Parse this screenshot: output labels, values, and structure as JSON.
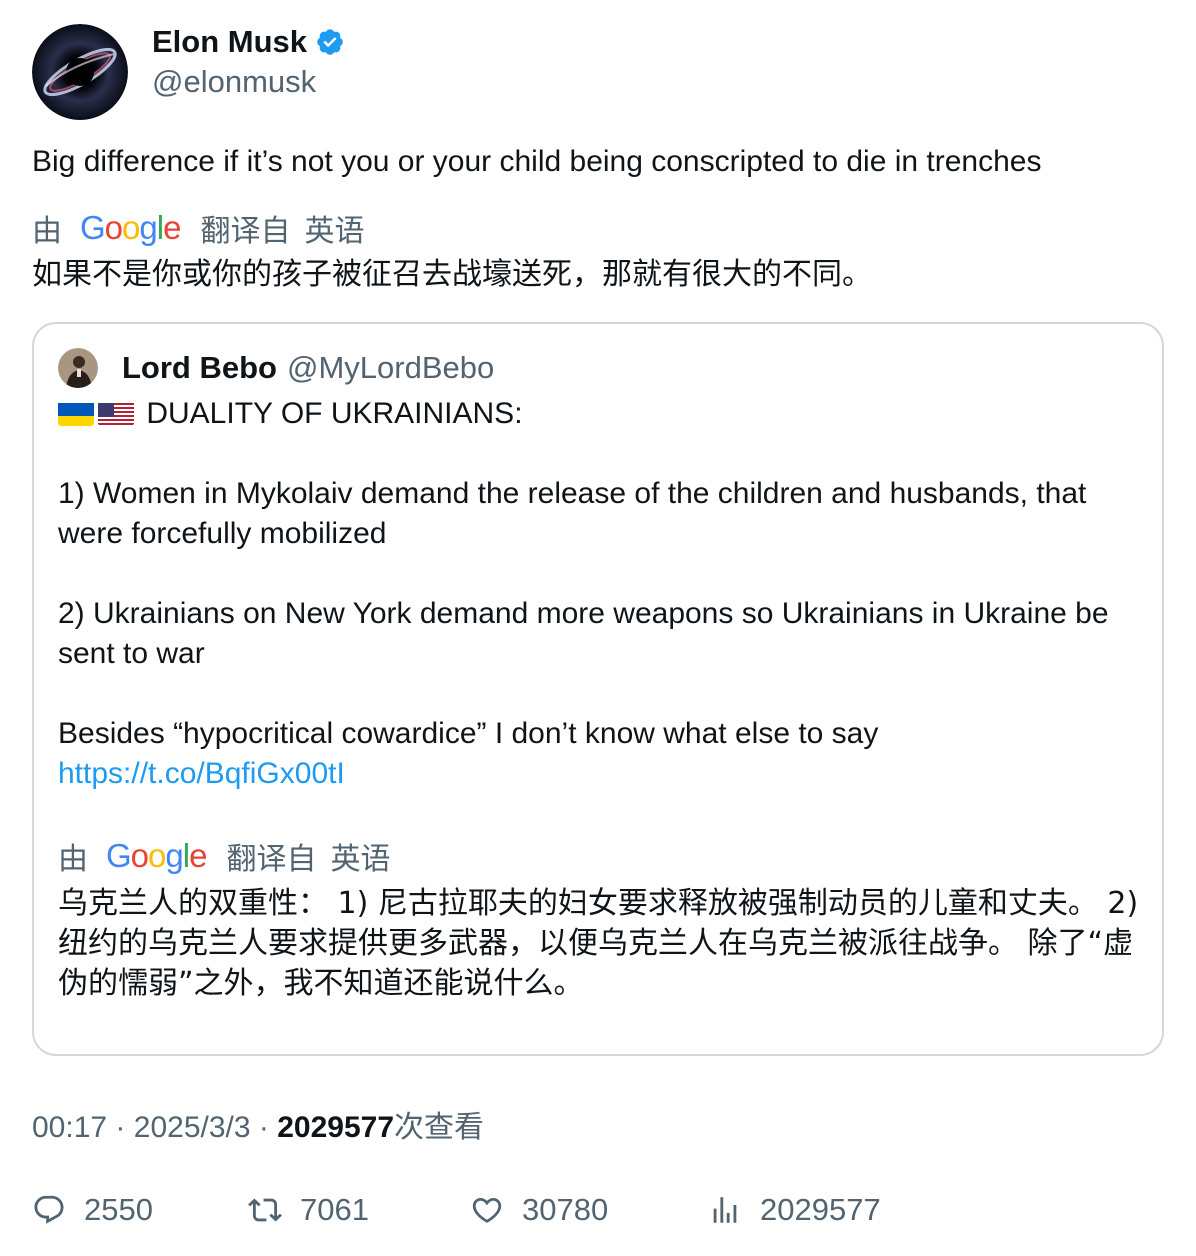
{
  "author": {
    "display_name": "Elon Musk",
    "handle": "@elonmusk",
    "verified": true,
    "avatar_icon": "black-hole-avatar"
  },
  "tweet": {
    "text": "Big difference if it’s not you or your child being conscripted to die in trenches",
    "translation_bar": {
      "by": "由",
      "provider": "Google",
      "translated_from": "翻译自",
      "language": "英语"
    },
    "translated_text": "如果不是你或你的孩子被征召去战壕送死，那就有很大的不同。"
  },
  "quoted": {
    "display_name": "Lord Bebo",
    "handle": "@MyLordBebo",
    "avatar_icon": "portrait-avatar",
    "lines": [
      "DUALITY OF UKRAINIANS:",
      "1) Women in Mykolaiv demand the release of the children and husbands, that were forcefully mobilized",
      "2) Ukrainians on New York demand more weapons so Ukrainians in Ukraine be sent to war",
      "Besides “hypocritical cowardice” I don’t know what else to say"
    ],
    "flags": [
      "ukraine-flag-icon",
      "usa-flag-icon"
    ],
    "link": "https://t.co/BqfiGx00tI",
    "translation_bar": {
      "by": "由",
      "provider": "Google",
      "translated_from": "翻译自",
      "language": "英语"
    },
    "translated_text": "乌克兰人的双重性： 1) 尼古拉耶夫的妇女要求释放被强制动员的儿童和丈夫。 2) 纽约的乌克兰人要求提供更多武器，以便乌克兰人在乌克兰被派往战争。 除了“虚伪的懦弱”之外，我不知道还能说什么。"
  },
  "meta": {
    "time": "00:17",
    "separator": "·",
    "date": "2025/3/3",
    "views_count": "2029577",
    "views_label": "次查看"
  },
  "actions": {
    "replies": "2550",
    "retweets": "7061",
    "likes": "30780",
    "views": "2029577"
  },
  "colors": {
    "text": "#0f1419",
    "secondary": "#536471",
    "link": "#1d9bf0",
    "verified": "#1d9bf0",
    "border": "#cfd9de"
  }
}
